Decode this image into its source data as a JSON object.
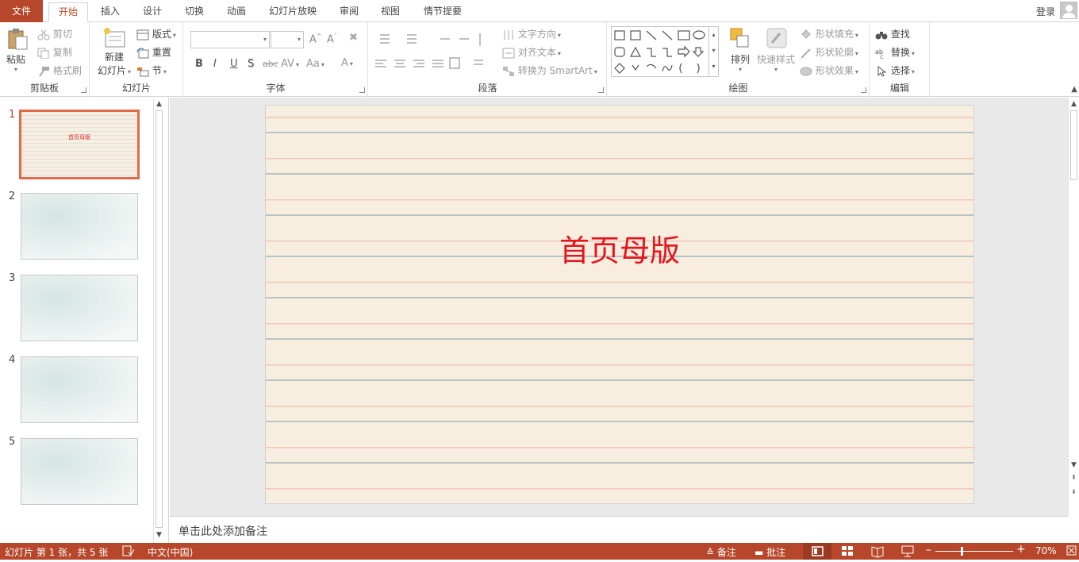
{
  "tabs": {
    "file": "文件",
    "items": [
      "开始",
      "插入",
      "设计",
      "切换",
      "动画",
      "幻灯片放映",
      "审阅",
      "视图",
      "情节提要"
    ],
    "active_index": 0
  },
  "account": {
    "login": "登录"
  },
  "ribbon": {
    "clipboard": {
      "label": "剪贴板",
      "paste": "粘贴",
      "cut": "剪切",
      "copy": "复制",
      "format_painter": "格式刷"
    },
    "slides": {
      "label": "幻灯片",
      "new_slide_line1": "新建",
      "new_slide_line2": "幻灯片",
      "layout": "版式",
      "reset": "重置",
      "section": "节"
    },
    "font": {
      "label": "字体",
      "font_name": "",
      "font_size": "",
      "bold": "B",
      "italic": "I",
      "underline": "U",
      "shadow": "S",
      "strike": "abc",
      "spacing": "AV",
      "case": "Aa",
      "color": "A"
    },
    "paragraph": {
      "label": "段落",
      "text_direction": "文字方向",
      "align_text": "对齐文本",
      "convert_smartart": "转换为 SmartArt"
    },
    "drawing": {
      "label": "绘图",
      "arrange": "排列",
      "quick_styles": "快速样式",
      "shape_fill": "形状填充",
      "shape_outline": "形状轮廓",
      "shape_effects": "形状效果"
    },
    "editing": {
      "label": "编辑",
      "find": "查找",
      "replace": "替换",
      "select": "选择"
    }
  },
  "thumbnails": [
    {
      "number": "1",
      "title": "首页母版",
      "style": "lined",
      "selected": true
    },
    {
      "number": "2",
      "title": "",
      "style": "cloud",
      "selected": false
    },
    {
      "number": "3",
      "title": "",
      "style": "cloud",
      "selected": false
    },
    {
      "number": "4",
      "title": "",
      "style": "cloud",
      "selected": false
    },
    {
      "number": "5",
      "title": "",
      "style": "cloud",
      "selected": false
    }
  ],
  "slide": {
    "title": "首页母版",
    "title_color": "#e8131d"
  },
  "notes": {
    "placeholder": "单击此处添加备注"
  },
  "status": {
    "slide_info": "幻灯片 第 1 张，共 5 张",
    "language": "中文(中国)",
    "notes_btn": "备注",
    "comments_btn": "批注",
    "zoom": "70%",
    "accent": "#b7472a"
  }
}
